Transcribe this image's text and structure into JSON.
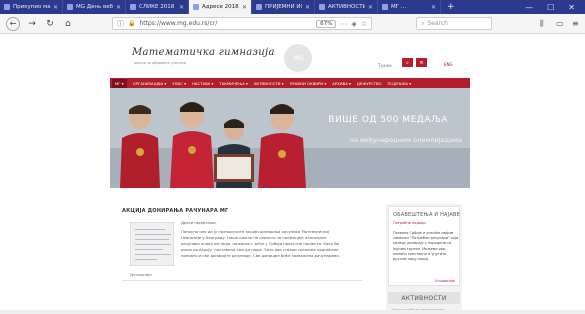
{
  "browser": {
    "tabs": [
      {
        "label": "Прикупио мате...",
        "active": false
      },
      {
        "label": "MG День вебер...",
        "active": false
      },
      {
        "label": "СЛИКЕ 2018 - ...",
        "active": false
      },
      {
        "label": "Адресе 2018 ...",
        "active": true
      },
      {
        "label": "ПРИЈЕМНИ ИСПИТ...",
        "active": false
      },
      {
        "label": "АКТИВНОСТИ - ...",
        "active": false
      },
      {
        "label": "МГ ...",
        "active": false
      }
    ],
    "new_tab": "+",
    "url": "https://www.mg.edu.rs/cr/",
    "zoom": "67%",
    "search_placeholder": "Search"
  },
  "site": {
    "logo": "Математичка гимназија",
    "logo_sub": "школа за обдарене ученике",
    "badge": "MG",
    "search_label": "Тражи",
    "lang": "ENG",
    "menu": [
      "МГ ▾",
      "ОРГАНИЗАЦИЈА ▾",
      "УПИС ▾",
      "НАСТАВА ▾",
      "ТАКМИЧЕЊА ▾",
      "АКТИВНОСТИ ▾",
      "ПРАВНИ ОКВИРИ ▾",
      "АРХИВА ▾",
      "ДЕЖУРСТВО",
      "ПОДРШКА ▾"
    ],
    "banner_line1": "ВИШЕ ОД 500 МЕДАЉА",
    "banner_line2": "на међународним олимпијадама"
  },
  "article": {
    "title": "АКЦИЈА ДОНИРАЊА РАЧУНАРА МГ",
    "greeting": "Драги пријатељи,",
    "body": "Поносни смо да ју препоручите акцији донирања рачунара Математичкој гимназији у Београду. Наша школа не користи за пројекције неопходне рачунаре онако изгледа, нажалост, ређе у Србији присутни пројекти. Како би ишли на карију, поставили смо да наше. Зато ове ствари тражимо пронађени поновно и све донирајте рачунаре. Све донације биће захваљена рачунарима.",
    "more": "Детаљније"
  },
  "sidebar": {
    "title": "ОБАВЕШТЕЊА И НАЈАВЕ",
    "subtitle": "Потребни подаци",
    "text": "Позвани Србије и учешће својим заменом \"Потребни рачунари\" који колеџу донирају у поредини са једним групом. Можемо ово, помоћи сопствено и упутити другим лицу нашој.",
    "more": "Опширније",
    "activities": "АКТИВНОСТИ",
    "activities_sub": "Школа најбоље математике"
  }
}
